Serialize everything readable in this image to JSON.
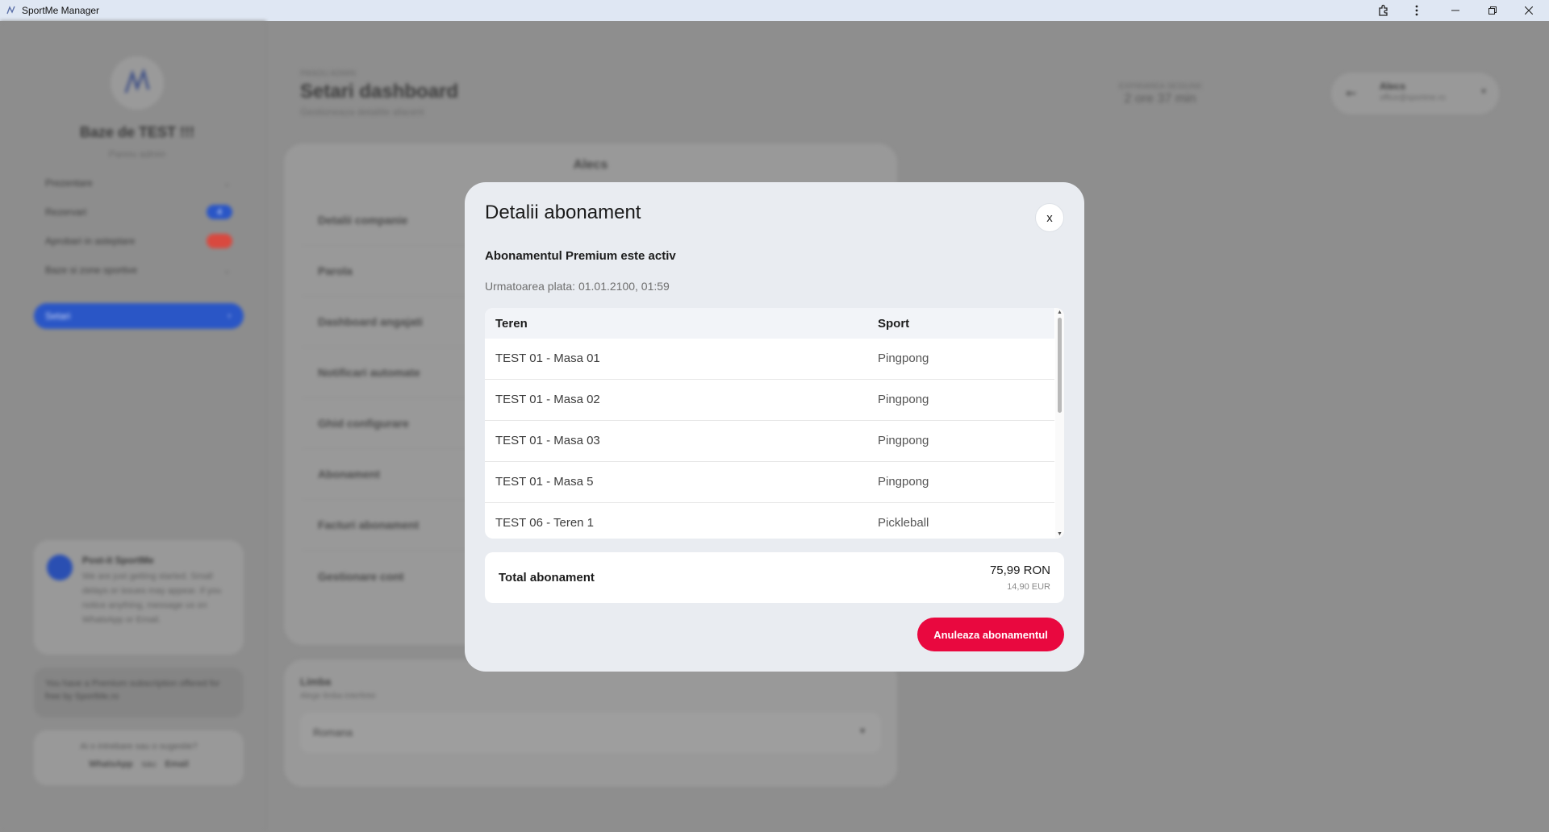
{
  "window": {
    "title": "SportMe Manager",
    "icons": [
      "extension-icon",
      "more-icon",
      "minimize-icon",
      "restore-icon",
      "close-icon"
    ]
  },
  "background": {
    "org_name": "Baze de TEST !!!",
    "org_subtitle": "Panou admin",
    "nav": [
      {
        "label": "Prezentare"
      },
      {
        "label": "Rezervari",
        "badge": "4",
        "badge_color": "#2a56c6"
      },
      {
        "label": "Aprobari in asteptare",
        "badge": "",
        "badge_color": "#d9493f"
      },
      {
        "label": "Baze si zone sportive"
      },
      {
        "label": "Setari"
      }
    ],
    "promo": {
      "title": "Post-it SportMe",
      "text": "We are just getting started. Small delays or issues may appear. If you notice anything, message us on WhatsApp or Email."
    },
    "premium_note": "You have a Premium subscription offered for free by SportMe.ro",
    "help": {
      "question": "Ai o intrebare sau o sugestie?",
      "whatsapp": "WhatsApp",
      "separator": "sau",
      "email": "Email"
    },
    "breadcrumb": "PANOU ADMIN",
    "page_title": "Setari dashboard",
    "page_subtitle": "Gestioneaza detaliile afacerii",
    "session_label": "EXPIRAREA SESIUNII",
    "session_value": "2 ore 37 min",
    "user": {
      "name": "Alecs",
      "email": "office@sportme.ro"
    },
    "settings_card_title": "Alecs",
    "settings_menu": [
      "Detalii companie",
      "Parola",
      "Dashboard angajati",
      "Notificari automate",
      "Ghid configurare",
      "Abonament",
      "Facturi abonament",
      "Gestionare cont"
    ],
    "language": {
      "title": "Limba",
      "subtitle": "Alege limba interfetei",
      "selected": "Romana"
    }
  },
  "modal": {
    "title": "Detalii abonament",
    "close_label": "x",
    "status": "Abonamentul Premium este activ",
    "next_payment": "Urmatoarea plata: 01.01.2100, 01:59",
    "table": {
      "headers": [
        "Teren",
        "Sport"
      ],
      "rows": [
        [
          "TEST 01 - Masa 01",
          "Pingpong"
        ],
        [
          "TEST 01 - Masa 02",
          "Pingpong"
        ],
        [
          "TEST 01 - Masa 03",
          "Pingpong"
        ],
        [
          "TEST 01 - Masa 5",
          "Pingpong"
        ],
        [
          "TEST 06 - Teren 1",
          "Pickleball"
        ]
      ]
    },
    "total": {
      "label": "Total abonament",
      "ron": "75,99 RON",
      "eur": "14,90 EUR"
    },
    "cancel_button": "Anuleaza abonamentul",
    "accent_color": "#e9083f"
  }
}
